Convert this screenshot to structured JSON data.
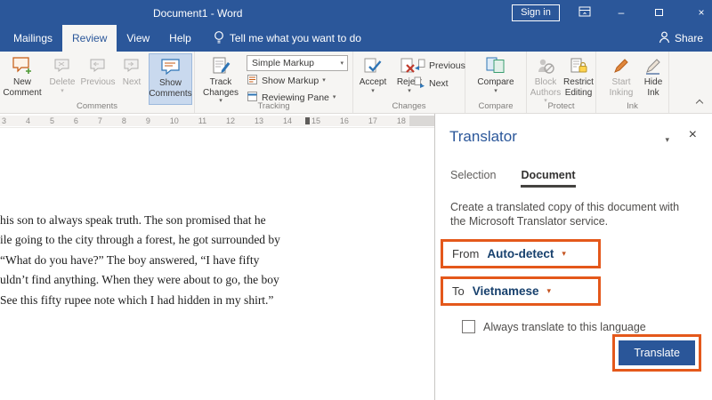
{
  "window": {
    "title": "Document1 - Word",
    "sign_in": "Sign in"
  },
  "icons": {
    "caret_down": "▾",
    "close": "×",
    "minimize": "–"
  },
  "tab_bar": {
    "tabs": [
      {
        "label": "Mailings"
      },
      {
        "label": "Review"
      },
      {
        "label": "View"
      },
      {
        "label": "Help"
      }
    ],
    "active_tab": "Review",
    "tell_me": "Tell me what you want to do",
    "share": "Share"
  },
  "ribbon": {
    "comments": {
      "label": "Comments",
      "new1": "New",
      "new2": "Comment",
      "delete": "Delete",
      "previous": "Previous",
      "next": "Next",
      "show1": "Show",
      "show2": "Comments"
    },
    "tracking": {
      "label": "Tracking",
      "track1": "Track",
      "track2": "Changes",
      "markup_value": "Simple Markup",
      "show_markup": "Show Markup",
      "reviewing_pane": "Reviewing Pane"
    },
    "changes": {
      "label": "Changes",
      "accept": "Accept",
      "reject": "Reject",
      "previous": "Previous",
      "next": "Next"
    },
    "compare": {
      "label": "Compare",
      "button": "Compare"
    },
    "protect": {
      "label": "Protect",
      "block1": "Block",
      "block2": "Authors",
      "restrict1": "Restrict",
      "restrict2": "Editing"
    },
    "ink": {
      "label": "Ink",
      "start1": "Start",
      "start2": "Inking",
      "hide1": "Hide",
      "hide2": "Ink"
    }
  },
  "ruler": {
    "numbers": [
      "3",
      "4",
      "5",
      "6",
      "7",
      "8",
      "9",
      "10",
      "11",
      "12",
      "13",
      "14",
      "15",
      "16",
      "17",
      "18"
    ]
  },
  "doc": {
    "lines": [
      "his son to always speak truth. The son promised that he",
      "ile going to the city through a forest, he got surrounded by",
      "“What do you have?” The boy answered, “I have fifty",
      "uldn’t find anything. When they were about to go, the boy",
      "See this fifty rupee note which I had hidden in my shirt.”"
    ]
  },
  "translator": {
    "title": "Translator",
    "tab_selection": "Selection",
    "tab_document": "Document",
    "description": "Create a translated copy of this document with the Microsoft Translator service.",
    "from_label": "From",
    "from_value": "Auto-detect",
    "to_label": "To",
    "to_value": "Vietnamese",
    "always_label": "Always translate to this language",
    "translate": "Translate"
  },
  "colors": {
    "accent": "#2b579a",
    "annotation": "#e4581b"
  }
}
